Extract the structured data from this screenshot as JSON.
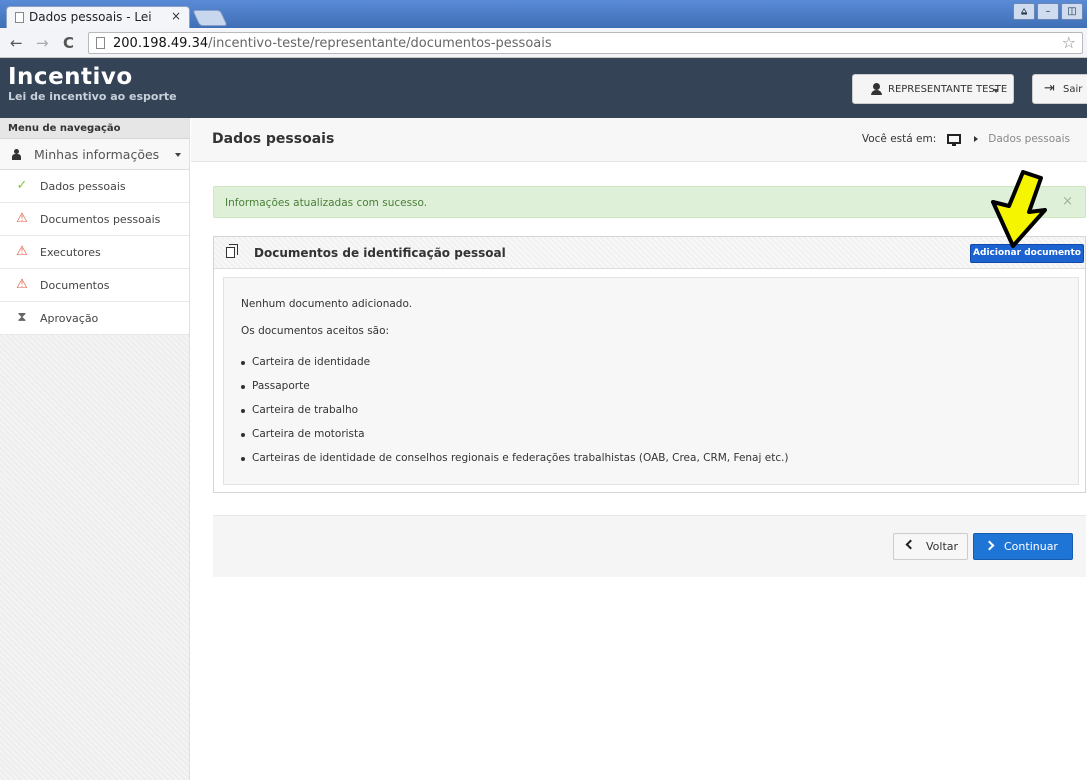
{
  "browser": {
    "tab_title": "Dados pessoais - Lei",
    "tab_close": "×",
    "url_host": "200.198.49.34",
    "url_path": "/incentivo-teste/representante/documentos-pessoais",
    "win_controls": [
      "⩠",
      "–",
      "◫"
    ],
    "back": "←",
    "forward": "→",
    "reload": "C",
    "star": "☆"
  },
  "header": {
    "app_name": "Incentivo",
    "app_subtitle": "Lei de incentivo ao esporte",
    "user_label": "REPRESENTANTE TESTE",
    "logout_label": "Sair"
  },
  "sidebar": {
    "title": "Menu de navegação",
    "group_label": "Minhas informações",
    "items": [
      {
        "label": "Dados pessoais",
        "icon": "check-icon",
        "glyph": "✓"
      },
      {
        "label": "Documentos pessoais",
        "icon": "warning-icon",
        "glyph": "⚠"
      },
      {
        "label": "Executores",
        "icon": "warning-icon",
        "glyph": "⚠"
      },
      {
        "label": "Documentos",
        "icon": "warning-icon",
        "glyph": "⚠"
      },
      {
        "label": "Aprovação",
        "icon": "hourglass-icon",
        "glyph": "⧗"
      }
    ]
  },
  "main": {
    "title": "Dados pessoais",
    "breadcrumb_prefix": "Você está em:",
    "breadcrumb_current": "Dados pessoais",
    "alert_text": "Informações atualizadas com sucesso.",
    "alert_close": "×",
    "panel": {
      "title": "Documentos de identificação pessoal",
      "add_button": "Adicionar documento",
      "empty_text": "Nenhum documento adicionado.",
      "accepted_intro": "Os documentos aceitos são:",
      "accepted": [
        "Carteira de identidade",
        "Passaporte",
        "Carteira de trabalho",
        "Carteira de motorista",
        "Carteiras de identidade de conselhos regionais e federações trabalhistas (OAB, Crea, CRM, Fenaj etc.)"
      ]
    },
    "back_button": "Voltar",
    "continue_button": "Continuar"
  },
  "colors": {
    "header_bg": "#344456",
    "primary": "#1f75d6",
    "success_bg": "#dff0d8",
    "annotation_arrow": "#f5f500"
  }
}
